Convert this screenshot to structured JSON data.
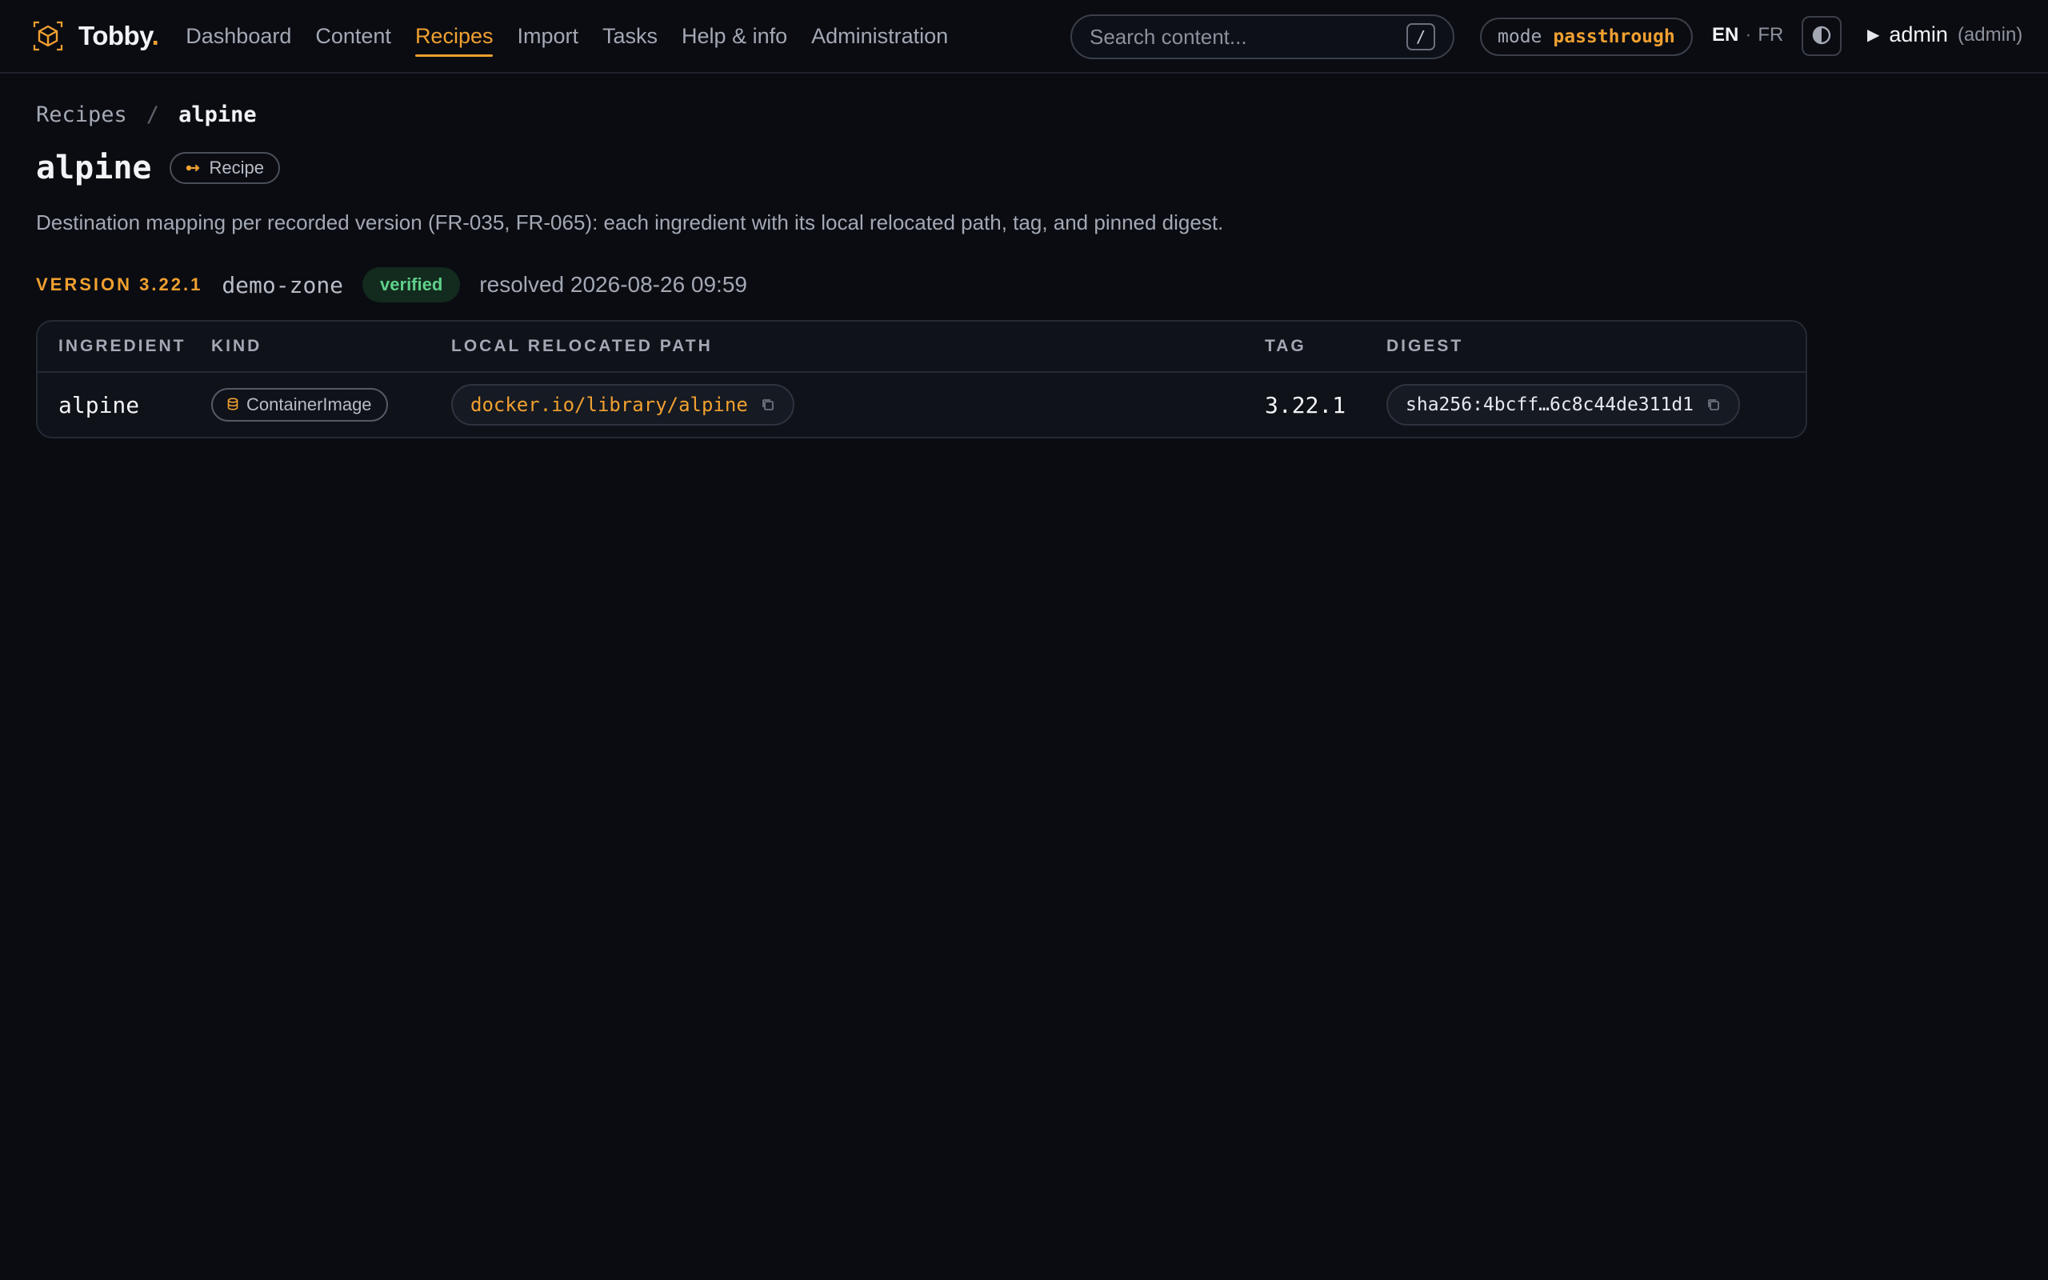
{
  "brand": {
    "name": "Tobby",
    "dot": ".",
    "accent": "#f0a030"
  },
  "nav": {
    "items": [
      {
        "label": "Dashboard",
        "active": false
      },
      {
        "label": "Content",
        "active": false
      },
      {
        "label": "Recipes",
        "active": true
      },
      {
        "label": "Import",
        "active": false
      },
      {
        "label": "Tasks",
        "active": false
      },
      {
        "label": "Help & info",
        "active": false
      },
      {
        "label": "Administration",
        "active": false
      }
    ]
  },
  "search": {
    "placeholder": "Search content...",
    "shortcut": "/"
  },
  "mode": {
    "label": "mode",
    "value": "passthrough"
  },
  "lang": {
    "current": "EN",
    "separator": "·",
    "other": "FR"
  },
  "theme_toggle": {
    "icon": "half-circle-icon"
  },
  "user": {
    "name": "admin",
    "role": "(admin)"
  },
  "breadcrumb": {
    "parent": "Recipes",
    "separator": "/",
    "current": "alpine"
  },
  "page": {
    "title": "alpine",
    "badge": "Recipe",
    "description": "Destination mapping per recorded version (FR-035, FR-065): each ingredient with its local relocated path, tag, and pinned digest."
  },
  "version": {
    "label": "VERSION 3.22.1",
    "zone": "demo-zone",
    "status": "verified",
    "resolved": "resolved 2026-08-26 09:59"
  },
  "table": {
    "headers": [
      "INGREDIENT",
      "KIND",
      "LOCAL RELOCATED PATH",
      "TAG",
      "DIGEST"
    ],
    "rows": [
      {
        "ingredient": "alpine",
        "kind": "ContainerImage",
        "path": "docker.io/library/alpine",
        "tag": "3.22.1",
        "digest": "sha256:4bcff…6c8c44de311d1"
      }
    ]
  }
}
